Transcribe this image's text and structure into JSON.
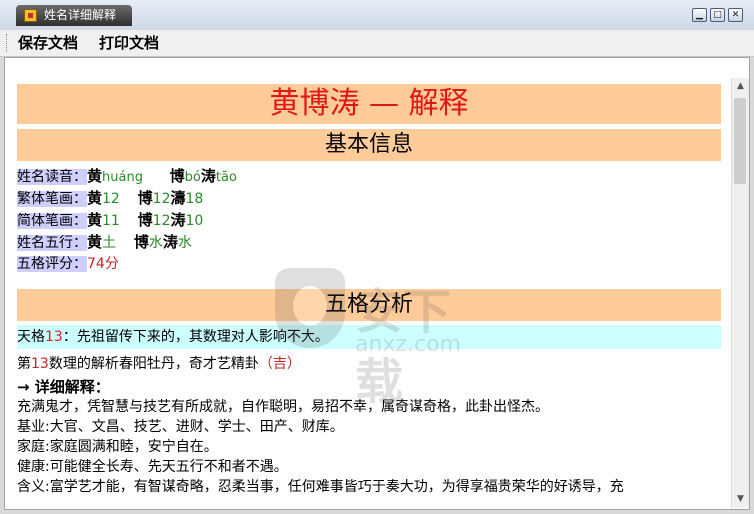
{
  "window": {
    "title": "姓名详细解释"
  },
  "menu": {
    "save": "保存文档",
    "print": "打印文档"
  },
  "doc": {
    "main_title": "黄博涛 — 解释",
    "basic_header": "基本信息",
    "reading_label": "姓名读音：",
    "reading": [
      {
        "char": "黄",
        "pinyin": "huáng"
      },
      {
        "char": "博",
        "pinyin": "bó"
      },
      {
        "char": "涛",
        "pinyin": "tāo"
      }
    ],
    "trad_label": "繁体笔画：",
    "trad": [
      {
        "char": "黄",
        "val": "12"
      },
      {
        "char": "博",
        "val": "12"
      },
      {
        "char": "濤",
        "val": "18"
      }
    ],
    "simp_label": "简体笔画：",
    "simp": [
      {
        "char": "黄",
        "val": "11"
      },
      {
        "char": "博",
        "val": "12"
      },
      {
        "char": "涛",
        "val": "10"
      }
    ],
    "wuxing_label": "姓名五行：",
    "wuxing": [
      {
        "char": "黄",
        "val": "土"
      },
      {
        "char": "博",
        "val": "水"
      },
      {
        "char": "涛",
        "val": "水"
      }
    ],
    "score_label": "五格评分：",
    "score": "74分",
    "wuge_header": "五格分析",
    "tiange_label": "天格",
    "tiange_num": "13",
    "tiange_text": "：先祖留传下来的，其数理对人影响不大。",
    "analysis_prefix": "第",
    "analysis_num": "13",
    "analysis_text": "数理的解析春阳牡丹，奇才艺精卦",
    "analysis_luck": "（吉）",
    "detail_label": "→ 详细解释：",
    "lines": [
      "充满鬼才，凭智慧与技艺有所成就，自作聪明，易招不幸，属奇谋奇格，此卦出怪杰。",
      "基业:大官、文昌、技艺、进财、学士、田产、财库。",
      "家庭:家庭圆满和睦，安宁自在。",
      "健康:可能健全长寿、先天五行不和者不遇。",
      "含义:富学艺才能，有智谋奇略，忍柔当事，任何难事皆巧于奏大功，为得享福贵荣华的好诱导，充"
    ]
  },
  "watermark": {
    "brand": "安下载",
    "domain": "anxz.com"
  }
}
